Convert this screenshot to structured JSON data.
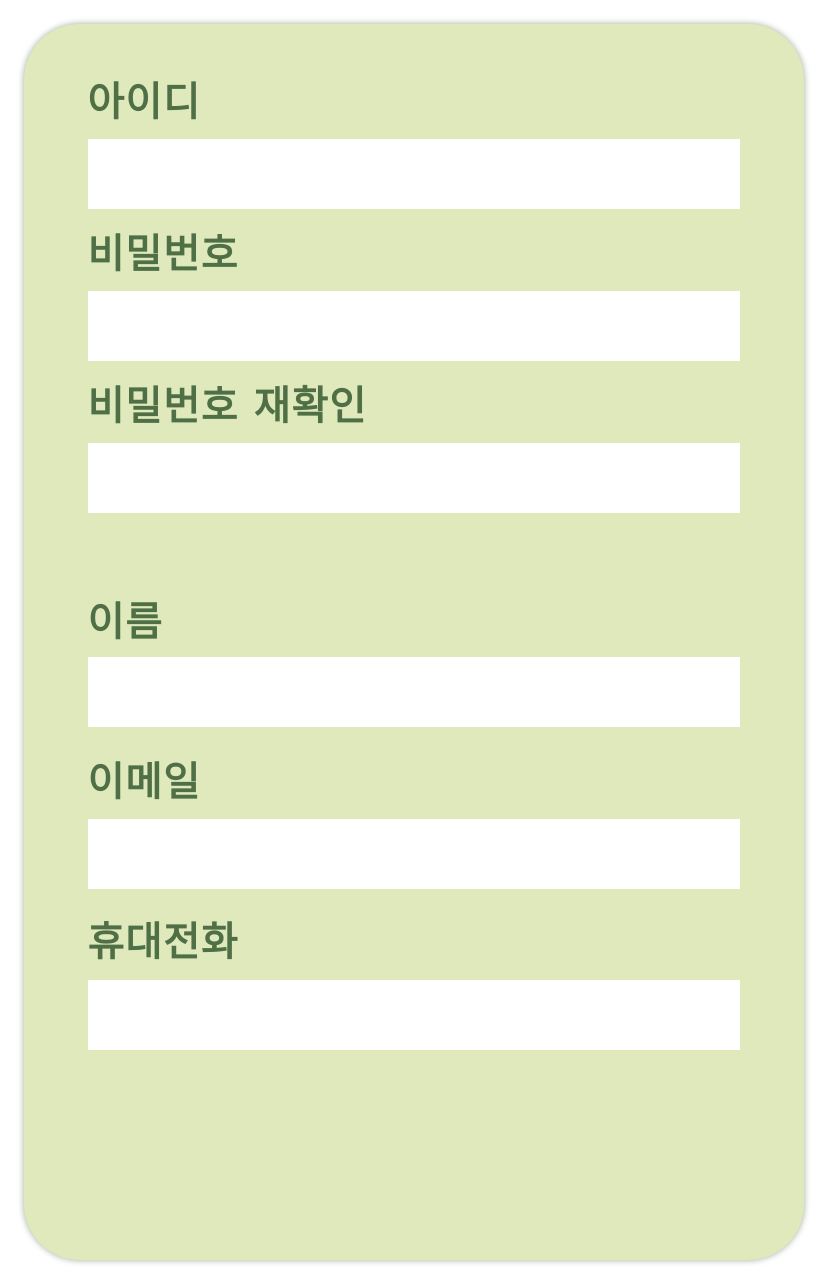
{
  "form": {
    "username_label": "아이디",
    "username_value": "",
    "password_label": "비밀번호",
    "password_value": "",
    "password_confirm_label": "비밀번호 재확인",
    "password_confirm_value": "",
    "name_label": "이름",
    "name_value": "",
    "email_label": "이메일",
    "email_value": "",
    "phone_label": "휴대전화",
    "phone_value": ""
  },
  "colors": {
    "card_background": "#dfe9bb",
    "label_text": "#4f7046",
    "field_background": "#ffffff"
  }
}
